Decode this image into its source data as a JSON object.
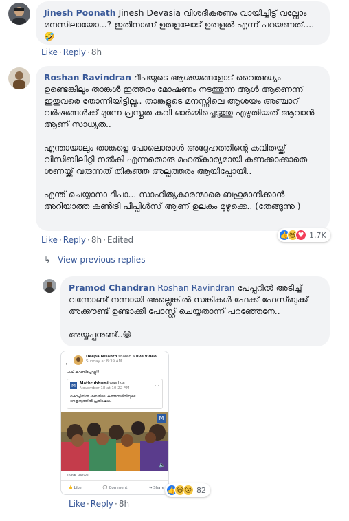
{
  "comments": [
    {
      "author": "Jinesh Poonath",
      "text": "Jinesh Devasia വിശദീകരണം വായിച്ചിട്ട് വല്ലോം മനസിലായോ...? ഇതിനാണ് ഉരുളലോട് ഉരുളൽ എന്ന് പറയണത്....🤣",
      "like": "Like",
      "reply": "Reply",
      "time": "8h"
    },
    {
      "author": "Roshan Ravindran",
      "paragraphs": [
        "ദീപയുടെ ആശയങ്ങളോട് വൈരുദ്ധ്യം ഉണ്ടെങ്കിലും താങ്കൾ ഇത്തരം മോഷണം നടത്തുന്ന ആൾ ആണെന്ന് ഇതുവരെ തോന്നിയിട്ടില്ല.. താങ്കളുടെ മനസ്സിലെ ആശയം അഞ്ചാറ് വർഷങ്ങൾക്ക് മുന്നേ പ്രസ്തുത കവി ഓർമ്മിച്ചെടുത്തു എഴുതിയത് ആവാൻ ആണ് സാധ്യത..",
        "എന്തായാലും താങ്കളെ പോലൊരാൾ അദ്ദേഹത്തിന്റെ കവിതയ്ക്ക് വിസിബിലിറ്റി നൽകി എന്നതൊരു മഹത്കാര്യമായി കണക്കാക്കാതെ ശണയ്ക്ക് വരുന്നത് തികഞ്ഞ അല്പത്തരം ആയിപ്പോയി..",
        "എന്ത് ചെയ്യാനാ ദീപാ... സാഹിത്യകാരന്മാരെ ബഹുമാനിക്കാൻ അറിയാത്ത കൺട്രി പീപ്പിൾസ് ആണ് ഉലകം മുഴുക്കെ.. (തേങ്ങുന്നു )"
      ],
      "like": "Like",
      "reply": "Reply",
      "time": "8h",
      "edited": "Edited",
      "reaction_count": "1.7K"
    }
  ],
  "view_previous": "View previous replies",
  "reply": {
    "author": "Pramod Chandran",
    "mention": "Roshan Ravindran",
    "text": "പേപ്പറിൽ അടിച്ച് വന്നോണ്ട് നന്നായി അല്ലെങ്കിൽ സങ്കികൾ ഫേക്ക് ഫേസ്ബുക്ക് അക്കൗണ്ട് ഉണ്ടാക്കി പോസ്റ്റ് ചെയ്യതാന്ന് പറഞ്ഞേനേ..",
    "text2": "അയ്യപ്പനുണ്ട്..😁",
    "like": "Like",
    "reply": "Reply",
    "time": "8h",
    "reaction_count": "82"
  },
  "shared_post": {
    "sharer": "Deepa Nisanth",
    "shared_text": "shared a",
    "live_text": "live video.",
    "date": "Sunday at 8:39 AM",
    "caption": "ചക് കാണിച്ചോളൂ!!",
    "page": "Mathrubhumi",
    "page_suffix": "was live.",
    "page_date": "November 18 at 10:22 AM",
    "desc": "കൊച്ചിയിൽ ശബരിമല കർമ്മസമിതിയുടെ നേതൃത്വത്തിൽ പ്രതിഷേധം",
    "views": "196K Views",
    "like": "Like",
    "comment": "Comment",
    "share": "Share"
  },
  "colors": {
    "link": "#385898",
    "bubble": "#f2f3f5",
    "meta": "#606770"
  }
}
